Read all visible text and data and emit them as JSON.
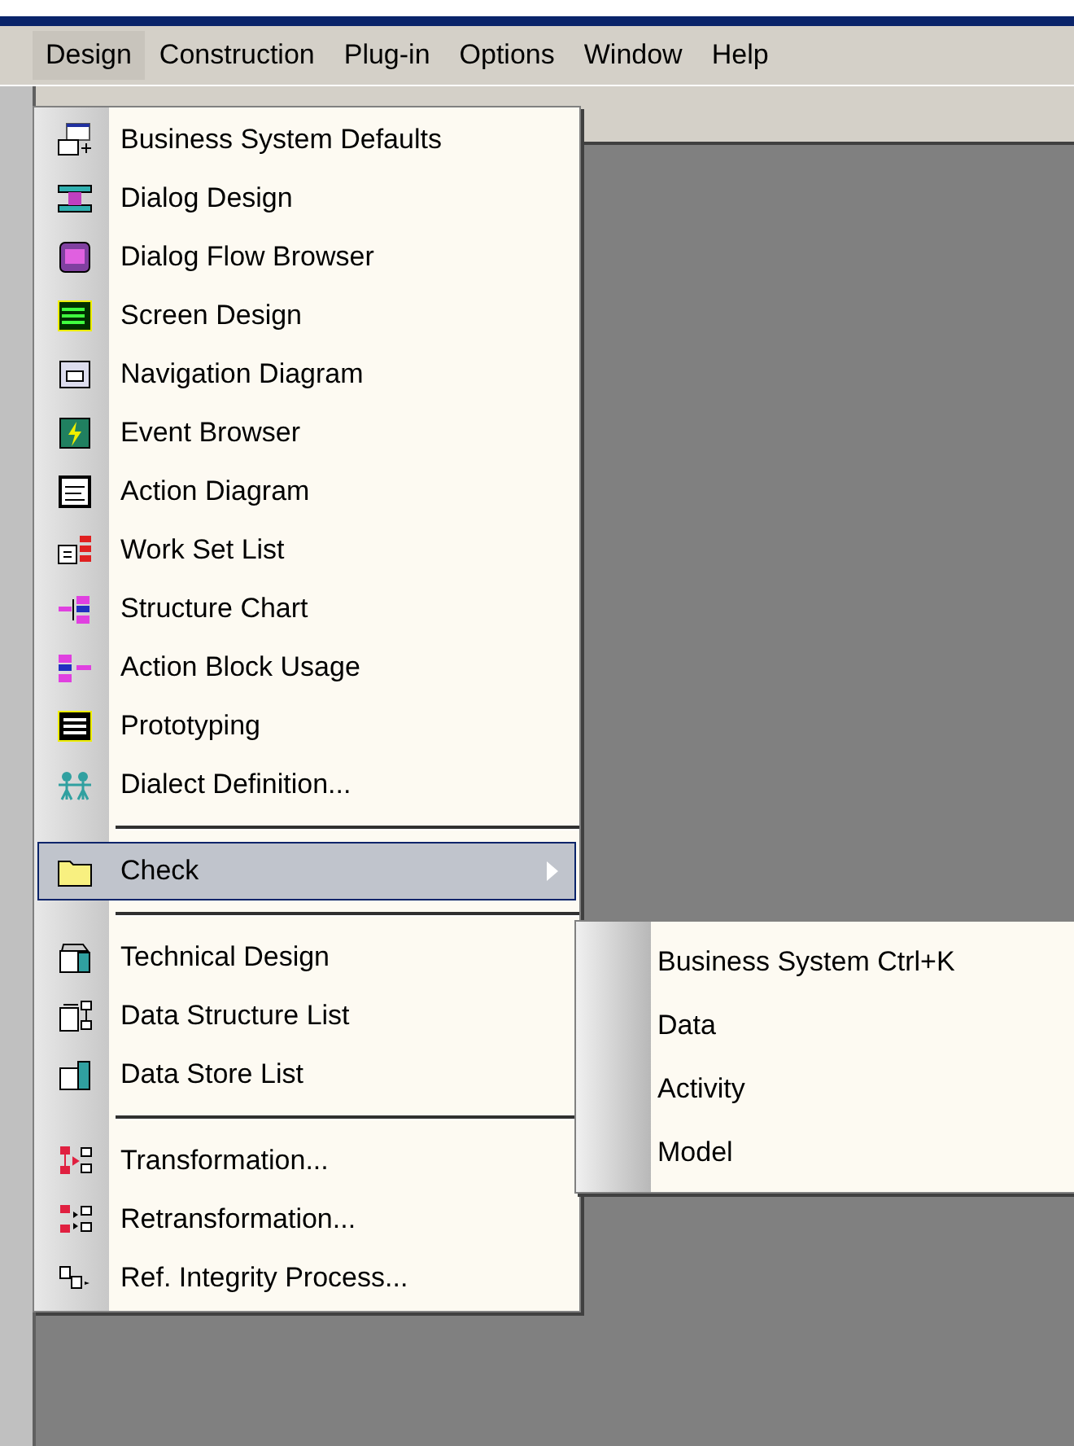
{
  "menubar": [
    {
      "label": "Design",
      "selected": true
    },
    {
      "label": "Construction",
      "selected": false
    },
    {
      "label": "Plug-in",
      "selected": false
    },
    {
      "label": "Options",
      "selected": false
    },
    {
      "label": "Window",
      "selected": false
    },
    {
      "label": "Help",
      "selected": false
    }
  ],
  "menu": {
    "sections": [
      [
        {
          "label": "Business System Defaults",
          "selected": false,
          "submenu": false
        },
        {
          "label": "Dialog Design",
          "selected": false,
          "submenu": false
        },
        {
          "label": "Dialog Flow Browser",
          "selected": false,
          "submenu": false
        },
        {
          "label": "Screen Design",
          "selected": false,
          "submenu": false
        },
        {
          "label": "Navigation Diagram",
          "selected": false,
          "submenu": false
        },
        {
          "label": "Event Browser",
          "selected": false,
          "submenu": false
        },
        {
          "label": "Action Diagram",
          "selected": false,
          "submenu": false
        },
        {
          "label": "Work Set List",
          "selected": false,
          "submenu": false
        },
        {
          "label": "Structure Chart",
          "selected": false,
          "submenu": false
        },
        {
          "label": "Action Block Usage",
          "selected": false,
          "submenu": false
        },
        {
          "label": "Prototyping",
          "selected": false,
          "submenu": false
        },
        {
          "label": "Dialect Definition...",
          "selected": false,
          "submenu": false
        }
      ],
      [
        {
          "label": "Check",
          "selected": true,
          "submenu": true
        }
      ],
      [
        {
          "label": "Technical Design",
          "selected": false,
          "submenu": false
        },
        {
          "label": "Data Structure List",
          "selected": false,
          "submenu": false
        },
        {
          "label": "Data Store List",
          "selected": false,
          "submenu": false
        }
      ],
      [
        {
          "label": "Transformation...",
          "selected": false,
          "submenu": false
        },
        {
          "label": "Retransformation...",
          "selected": false,
          "submenu": false
        },
        {
          "label": "Ref. Integrity Process...",
          "selected": false,
          "submenu": false
        }
      ]
    ]
  },
  "submenu": {
    "items": [
      {
        "label": "Business System Ctrl+K"
      },
      {
        "label": "Data"
      },
      {
        "label": "Activity"
      },
      {
        "label": "Model"
      }
    ]
  }
}
